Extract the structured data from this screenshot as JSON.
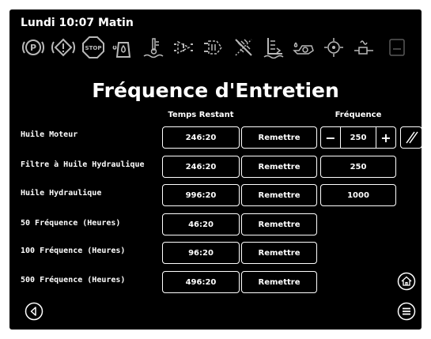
{
  "header": {
    "datetime": "Lundi 10:07 Matin"
  },
  "title": "Fréquence d'Entretien",
  "columns": {
    "remaining": "Temps Restant",
    "frequency": "Fréquence"
  },
  "rows": [
    {
      "label": "Huile Moteur",
      "remaining": "246:20",
      "reset": "Remettre",
      "frequency": "250",
      "editable": true
    },
    {
      "label": "Filtre à Huile Hydraulique",
      "remaining": "246:20",
      "reset": "Remettre",
      "frequency": "250"
    },
    {
      "label": "Huile Hydraulique",
      "remaining": "996:20",
      "reset": "Remettre",
      "frequency": "1000"
    },
    {
      "label": "50 Fréquence (Heures)",
      "remaining": "46:20",
      "reset": "Remettre"
    },
    {
      "label": "100 Fréquence (Heures)",
      "remaining": "96:20",
      "reset": "Remettre"
    },
    {
      "label": "500 Fréquence (Heures)",
      "remaining": "496:20",
      "reset": "Remettre"
    }
  ],
  "stepper": {
    "minus": "−",
    "plus": "+"
  },
  "icons": [
    "parking-brake-icon",
    "warning-icon",
    "stop-icon",
    "fuel-water-icon",
    "coolant-temp-icon",
    "engine-oil-pressure-icon",
    "hydraulic-filter-icon",
    "air-filter-icon",
    "hydraulic-oil-level-icon",
    "engine-oil-icon",
    "hydraulic-pressure-icon",
    "glow-plug-icon",
    "fuel-level-icon"
  ],
  "nav": {
    "back": "back-icon",
    "home": "home-icon",
    "menu": "menu-icon",
    "edit": "edit-slash-icon"
  }
}
